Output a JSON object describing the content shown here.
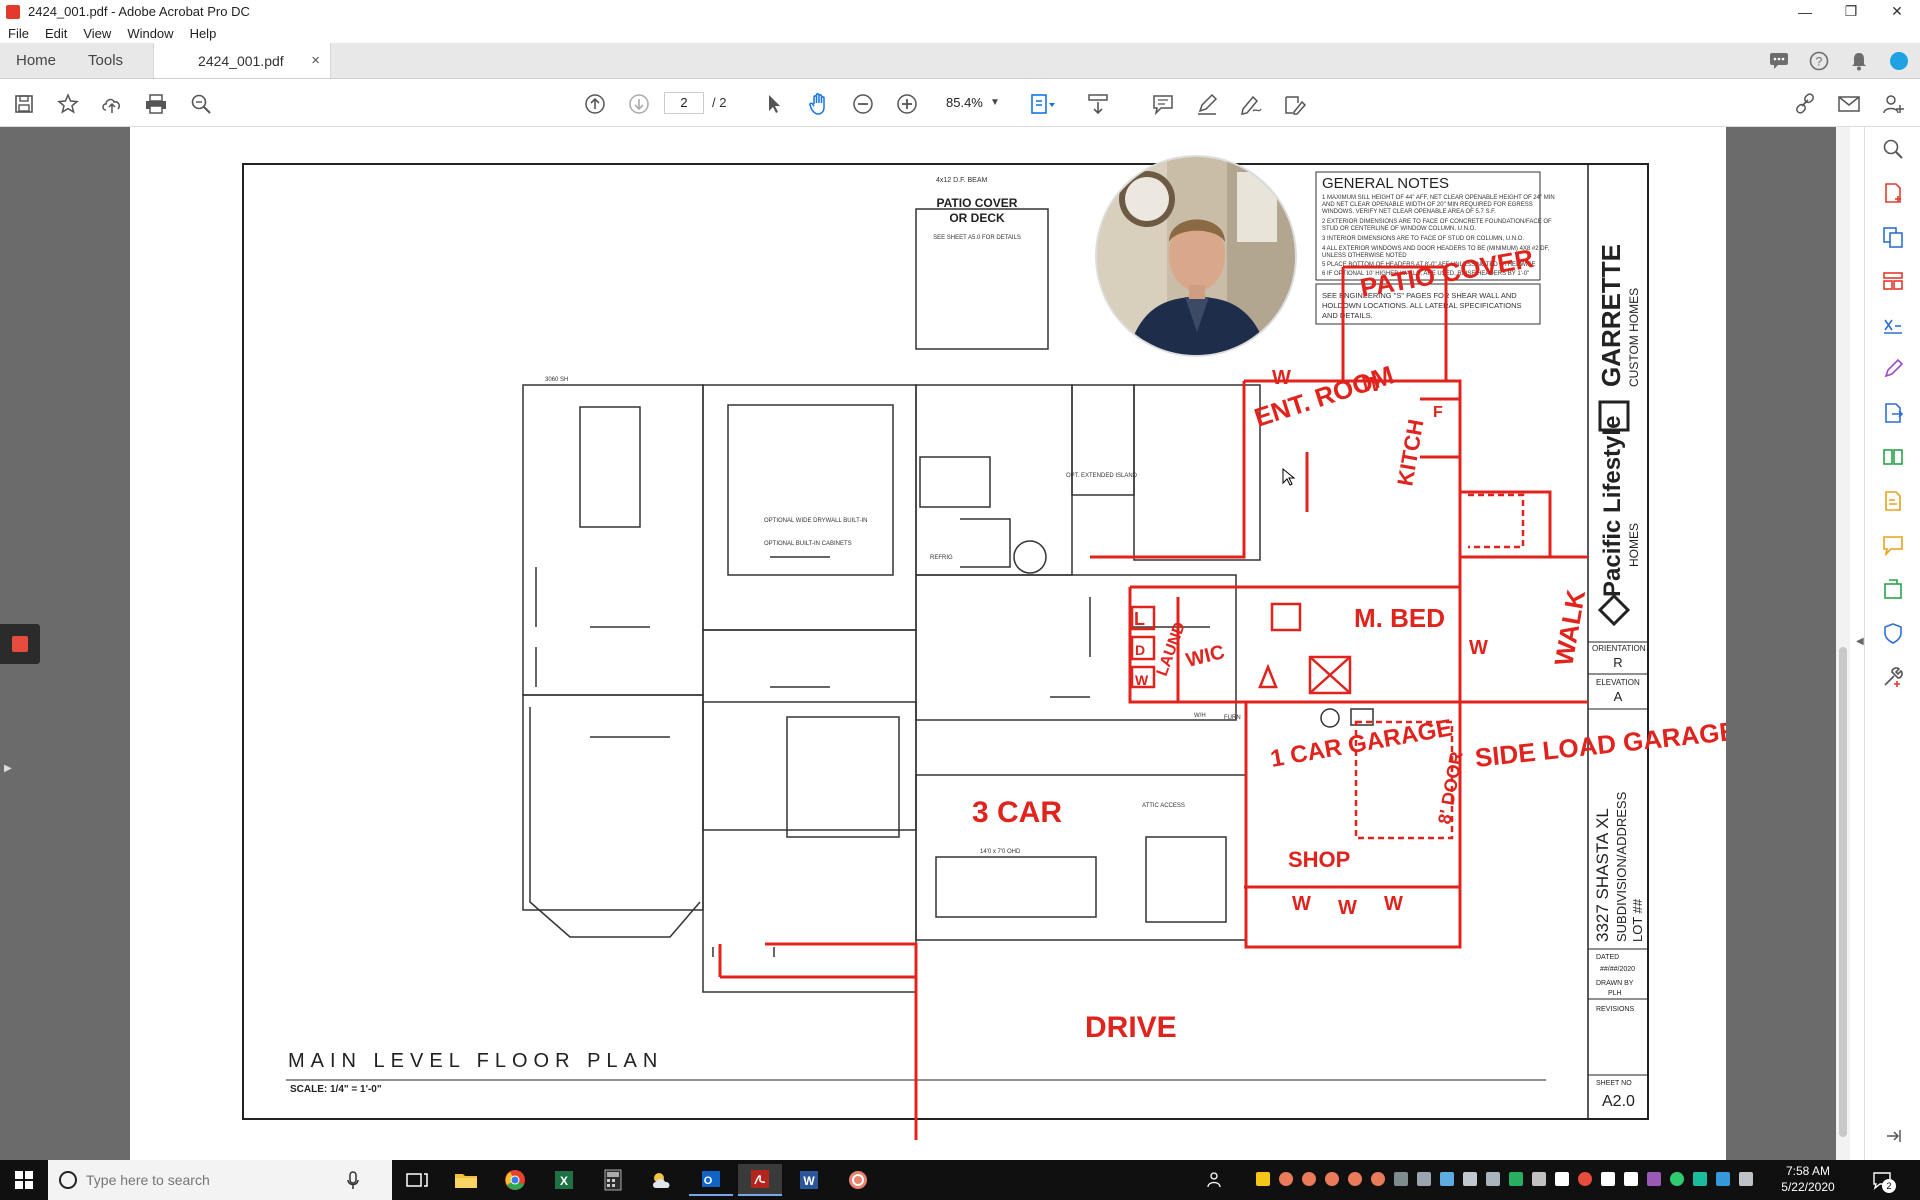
{
  "window": {
    "title": "2424_001.pdf - Adobe Acrobat Pro DC"
  },
  "menu": [
    "File",
    "Edit",
    "View",
    "Window",
    "Help"
  ],
  "tabs": {
    "home": "Home",
    "tools": "Tools",
    "doc": "2424_001.pdf",
    "close": "×"
  },
  "toolbar": {
    "page_current": "2",
    "page_total": "/ 2",
    "zoom": "85.4%"
  },
  "plan": {
    "title": "MAIN  LEVEL  FLOOR  PLAN",
    "scale": "SCALE: 1/4\" = 1'-0\"",
    "patio": [
      "PATIO COVER",
      "OR DECK"
    ],
    "patio_note": "SEE SHEET A5.0 FOR DETAILS",
    "patio_top": "4x12 D.F. BEAM",
    "notes_title": "GENERAL NOTES",
    "notes_lines": [
      "1  MAXIMUM SILL HEIGHT OF 44\" AFF, NET CLEAR OPENABLE HEIGHT OF 24\" MIN",
      "   AND NET CLEAR OPENABLE WIDTH OF 20\" MIN REQUIRED FOR EGRESS",
      "   WINDOWS. VERIFY NET CLEAR OPENABLE AREA OF 5.7 S.F.",
      "2  EXTERIOR DIMENSIONS ARE TO FACE OF CONCRETE FOUNDATION/FACE OF",
      "   STUD OR CENTERLINE OF WINDOW COLUMN, U.N.O.",
      "3  INTERIOR DIMENSIONS ARE TO FACE OF STUD OR COLUMN, U.N.O.",
      "4  ALL EXTERIOR WINDOWS AND DOOR HEADERS TO BE (MINIMUM) 4X8 #2 DF,",
      "   UNLESS OTHERWISE NOTED",
      "5  PLACE BOTTOM OF HEADERS AT 8'-0\" AFF UNLESS NOTED OTHERWISE",
      "6  IF OPTIONAL 10' HIGHER WALLS, ARE USED, RAISE HEADERS BY 1'-0\""
    ],
    "shear_note": [
      "SEE ENGINEERING \"S\" PAGES FOR SHEAR WALL AND",
      "HOLDOWN LOCATIONS. ALL LATERAL SPECIFICATIONS",
      "AND DETAILS."
    ],
    "title_block": {
      "brand": "GARRETTE",
      "brand_sub": "CUSTOM HOMES",
      "company": "Pacific Lifestyle",
      "company_sub": "HOMES",
      "orientation_label": "ORIENTATION",
      "orientation": "R",
      "elevation_label": "ELEVATION",
      "elevation": "A",
      "plan_name": "3327 SHASTA XL",
      "subdivision": "SUBDIVISION/ADDRESS",
      "lot": "LOT ##",
      "dated_label": "DATED",
      "dated": "##/##/2020",
      "drawn_label": "DRAWN BY",
      "drawn": "PLH",
      "revisions_label": "REVISIONS",
      "sheet_label": "SHEET NO",
      "sheet": "A2.0"
    },
    "room_labels": [
      "OPT. EXTENDED ISLAND",
      "OPTIONAL WIDE DRYWALL BUILT-IN",
      "OPTIONAL BUILT-IN CABINETS",
      "REFRIG",
      "ATTIC ACCESS",
      "FURN",
      "W/H",
      "3060 SH",
      "14'0 x 7'0 OHD"
    ],
    "annotations": [
      "PATIO COVER",
      "ENT. ROOM",
      "KITCH",
      "WALK",
      "M. BED",
      "WIC",
      "LAUND",
      "1 CAR GARAGE",
      "8' DOOR",
      "SIDE LOAD GARAGE",
      "SHOP",
      "3 CAR",
      "DRIVE",
      "W",
      "L",
      "D",
      "F"
    ]
  },
  "taskbar": {
    "search_placeholder": "Type here to search",
    "time": "7:58 AM",
    "date": "5/22/2020",
    "notif_count": "2"
  }
}
